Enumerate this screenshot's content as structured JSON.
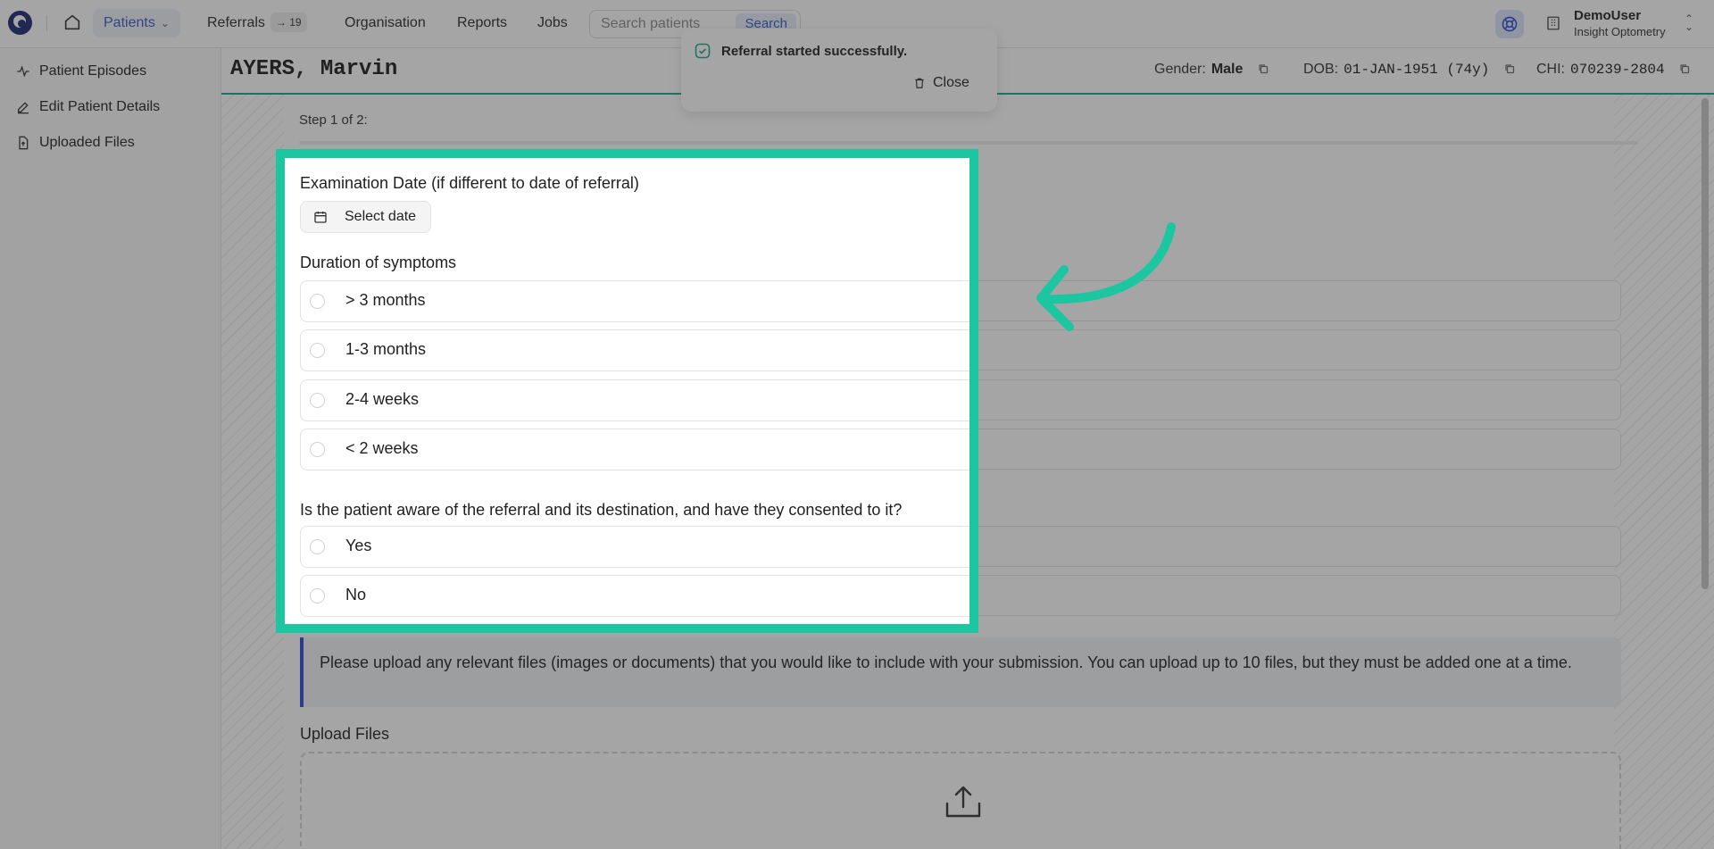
{
  "nav": {
    "patients": "Patients",
    "referrals": "Referrals",
    "referrals_badge": "→ 19",
    "organisation": "Organisation",
    "reports": "Reports",
    "jobs": "Jobs"
  },
  "search": {
    "placeholder": "Search patients",
    "button": "Search"
  },
  "user": {
    "name": "DemoUser",
    "organisation": "Insight Optometry"
  },
  "sidebar": {
    "items": [
      {
        "label": "Patient Episodes",
        "icon": "activity-icon"
      },
      {
        "label": "Edit Patient Details",
        "icon": "pencil-icon"
      },
      {
        "label": "Uploaded Files",
        "icon": "file-upload-icon"
      }
    ]
  },
  "patient": {
    "name": "AYERS, Marvin",
    "gender_label": "Gender:",
    "gender": "Male",
    "dob_label": "DOB:",
    "dob": "01-JAN-1951 (74y)",
    "chi_label": "CHI:",
    "chi": "070239-2804"
  },
  "toast": {
    "message": "Referral started successfully.",
    "close_label": "Close"
  },
  "form": {
    "step_label": "Step 1 of 2:",
    "examination_date": {
      "label": "Examination Date (if different to date of referral)",
      "button": "Select date"
    },
    "duration": {
      "label": "Duration of symptoms",
      "options": [
        "> 3 months",
        "1-3 months",
        "2-4 weeks",
        "< 2 weeks"
      ]
    },
    "consent": {
      "label": "Is the patient aware of the referral and its destination, and have they consented to it?",
      "options": [
        "Yes",
        "No"
      ]
    },
    "info_text": "Please upload any relevant files (images or documents) that you would like to include with your submission. You can upload up to 10 files, but they must be added one at a time.",
    "upload_label": "Upload Files"
  },
  "colors": {
    "highlight": "#1cc6a0",
    "accent": "#3a5bc7",
    "patient_bar_border": "#16a98c",
    "info_border": "#2f4fd3"
  }
}
